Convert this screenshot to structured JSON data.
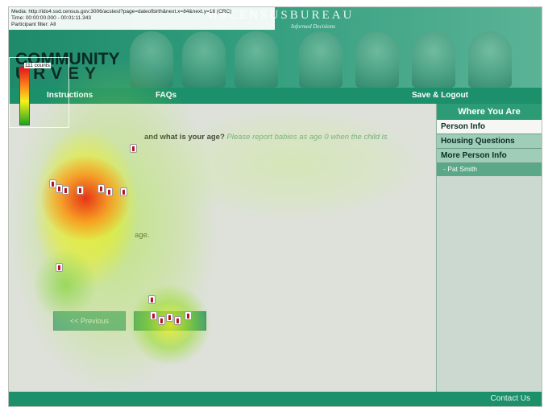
{
  "banner": {
    "bureau_title": "USCENSUSBUREAU",
    "tagline": "Informed Decisions",
    "logo_line1": "COMMUNITY",
    "logo_line2": "URVEY"
  },
  "gaze_info": {
    "media": "Media: http://ido4.ssd.census.gov:3006/acstest?page=dateofbirth&next.x=84&next.y=16 (CRC)",
    "time": "Time: 00:00:00.000 - 00:01:11.343",
    "participant_filter": "Participant filter: All",
    "counts": "111 counts"
  },
  "nav": {
    "instructions": "Instructions",
    "faqs": "FAQs",
    "save_logout": "Save & Logout"
  },
  "question": {
    "text": "and what is your age?",
    "hint": "Please report babies as age 0 when the child is",
    "age_label": "age."
  },
  "buttons": {
    "previous": "<< Previous",
    "next": ""
  },
  "sidebar": {
    "title": "Where You Are",
    "items": [
      {
        "label": "Person Info",
        "active": true
      },
      {
        "label": "Housing Questions",
        "active": false
      },
      {
        "label": "More Person Info",
        "active": false
      }
    ],
    "sub_items": [
      "- Pat Smith"
    ]
  },
  "footer": {
    "contact": "Contact Us"
  },
  "colors": {
    "brand_green": "#1c8f6b",
    "heat_red": "#e0101a",
    "heat_orange": "#ff8c1a",
    "heat_yellow": "#f2f21a",
    "heat_green": "#1fa21f"
  }
}
